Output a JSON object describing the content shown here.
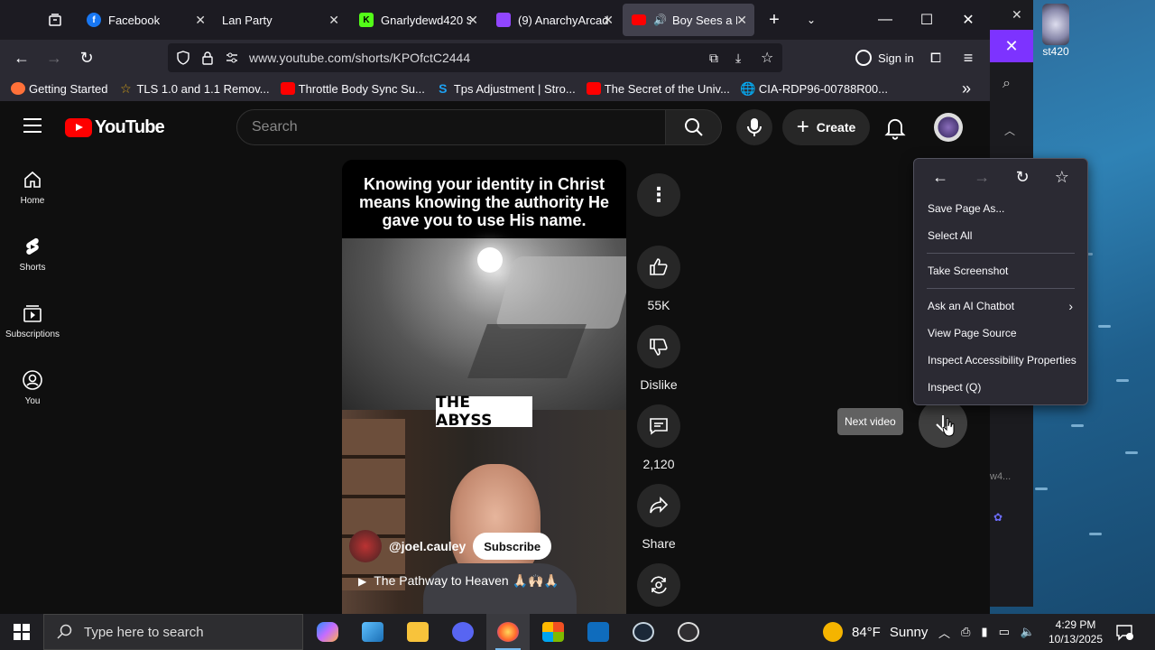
{
  "browser": {
    "tabs": [
      {
        "title": "Facebook",
        "favicon_color": "#1877f2",
        "favicon_letter": "f"
      },
      {
        "title": "Lan Party",
        "favicon_color": "",
        "favicon_letter": ""
      },
      {
        "title": "Gnarlydewd420 S",
        "favicon_color": "#53fc18",
        "favicon_letter": "K"
      },
      {
        "title": "(9) AnarchyArcad",
        "favicon_color": "#9146ff",
        "favicon_letter": ""
      },
      {
        "title": "Boy Sees a D",
        "favicon_color": "#ff0000",
        "favicon_letter": "",
        "active": true
      }
    ],
    "url": "www.youtube.com/shorts/KPOfctC2444",
    "sign_in": "Sign in",
    "bookmarks": [
      {
        "label": "Getting Started",
        "icon_color": "#ff7139"
      },
      {
        "label": "TLS 1.0 and 1.1 Remov...",
        "icon_color": "#d4a017"
      },
      {
        "label": "Throttle Body Sync Su...",
        "icon_color": "#ff0000"
      },
      {
        "label": "Tps Adjustment | Stro...",
        "icon_color": "#1da1f2"
      },
      {
        "label": "The Secret of the Univ...",
        "icon_color": "#ff0000"
      },
      {
        "label": "CIA-RDP96-00788R00...",
        "icon_color": "#cccccc"
      }
    ]
  },
  "youtube": {
    "logo_text": "YouTube",
    "search_placeholder": "Search",
    "create_label": "Create",
    "sidebar": [
      {
        "label": "Home"
      },
      {
        "label": "Shorts"
      },
      {
        "label": "Subscriptions"
      },
      {
        "label": "You"
      }
    ],
    "short": {
      "caption": "Knowing your identity in Christ means knowing the authority He gave you to use His name.",
      "overlay_text": "THE ABYSS",
      "channel": "@joel.cauley",
      "subscribe_label": "Subscribe",
      "playlist": "The Pathway to Heaven 🙏🏻🙌🏻🙏🏻"
    },
    "actions": {
      "likes": "55K",
      "dislike_label": "Dislike",
      "comments": "2,120",
      "share_label": "Share"
    },
    "next_tooltip": "Next video"
  },
  "context_menu": {
    "items": [
      "Save Page As...",
      "Select All",
      "Take Screenshot",
      "Ask an AI Chatbot",
      "View Page Source",
      "Inspect Accessibility Properties",
      "Inspect (Q)"
    ]
  },
  "desktop": {
    "icon_label": "st420",
    "bg_window_text": "w4..."
  },
  "taskbar": {
    "search_placeholder": "Type here to search",
    "weather_temp": "84°F",
    "weather_cond": "Sunny",
    "time": "4:29 PM",
    "date": "10/13/2025"
  }
}
